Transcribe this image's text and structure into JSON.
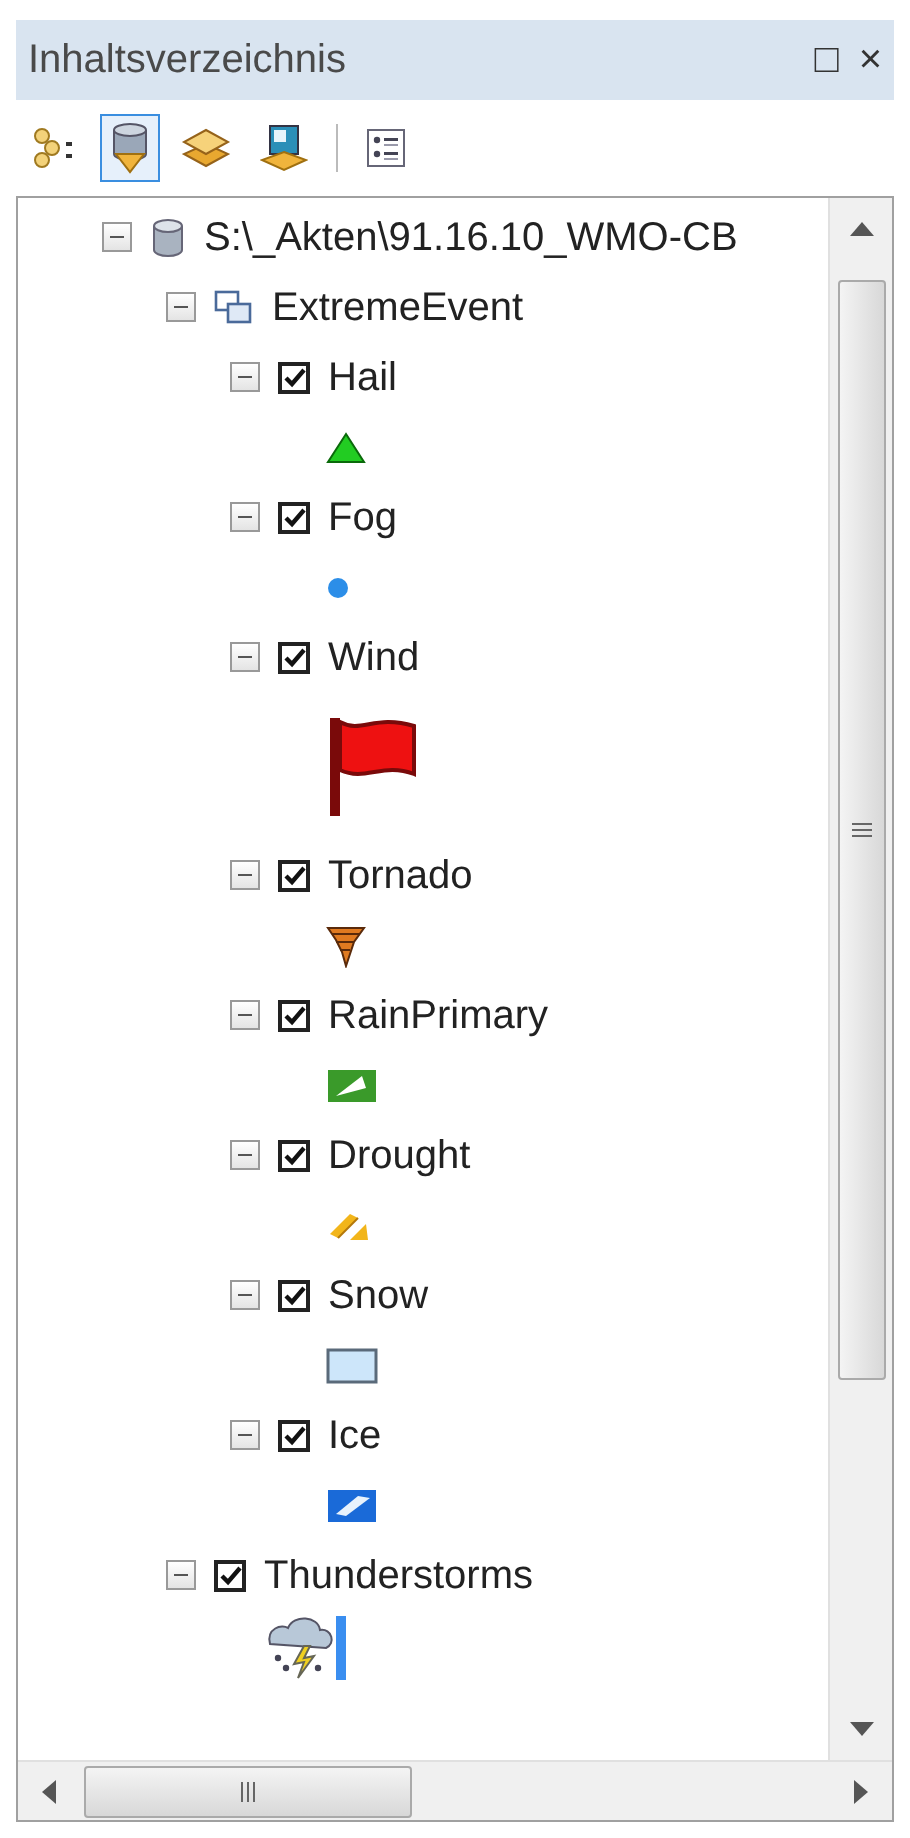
{
  "window": {
    "title": "Inhaltsverzeichnis",
    "buttons": [
      "□",
      "×"
    ]
  },
  "toolbar": [
    {
      "kind": "drawing-order",
      "selected": false
    },
    {
      "kind": "source",
      "selected": true
    },
    {
      "kind": "visibility",
      "selected": false
    },
    {
      "kind": "selection",
      "selected": false
    },
    {
      "kind": "separator"
    },
    {
      "kind": "options",
      "selected": false
    }
  ],
  "tree": [
    {
      "kind": "database",
      "label": "S:\\_Akten\\91.16.10_WMO-CB",
      "expanded": true,
      "children": [
        {
          "kind": "group",
          "label": "ExtremeEvent",
          "expanded": true,
          "children": [
            {
              "kind": "layer",
              "label": "Hail",
              "expanded": true,
              "checked": true,
              "symbol": {
                "kind": "triangle"
              }
            },
            {
              "kind": "layer",
              "label": "Fog",
              "expanded": true,
              "checked": true,
              "symbol": {
                "kind": "dot"
              }
            },
            {
              "kind": "layer",
              "label": "Wind",
              "expanded": true,
              "checked": true,
              "symbol": {
                "kind": "flag"
              }
            },
            {
              "kind": "layer",
              "label": "Tornado",
              "expanded": true,
              "checked": true,
              "symbol": {
                "kind": "tornado"
              }
            },
            {
              "kind": "layer",
              "label": "RainPrimary",
              "expanded": true,
              "checked": true,
              "symbol": {
                "kind": "green-square"
              }
            },
            {
              "kind": "layer",
              "label": "Drought",
              "expanded": true,
              "checked": true,
              "symbol": {
                "kind": "stripes"
              }
            },
            {
              "kind": "layer",
              "label": "Snow",
              "expanded": true,
              "checked": true,
              "symbol": {
                "kind": "pale-square"
              }
            },
            {
              "kind": "layer",
              "label": "Ice",
              "expanded": true,
              "checked": true,
              "symbol": {
                "kind": "blue-square"
              }
            }
          ]
        },
        {
          "kind": "layer",
          "label": "Thunderstorms",
          "expanded": true,
          "checked": true,
          "symbol": {
            "kind": "storm"
          }
        }
      ]
    }
  ]
}
